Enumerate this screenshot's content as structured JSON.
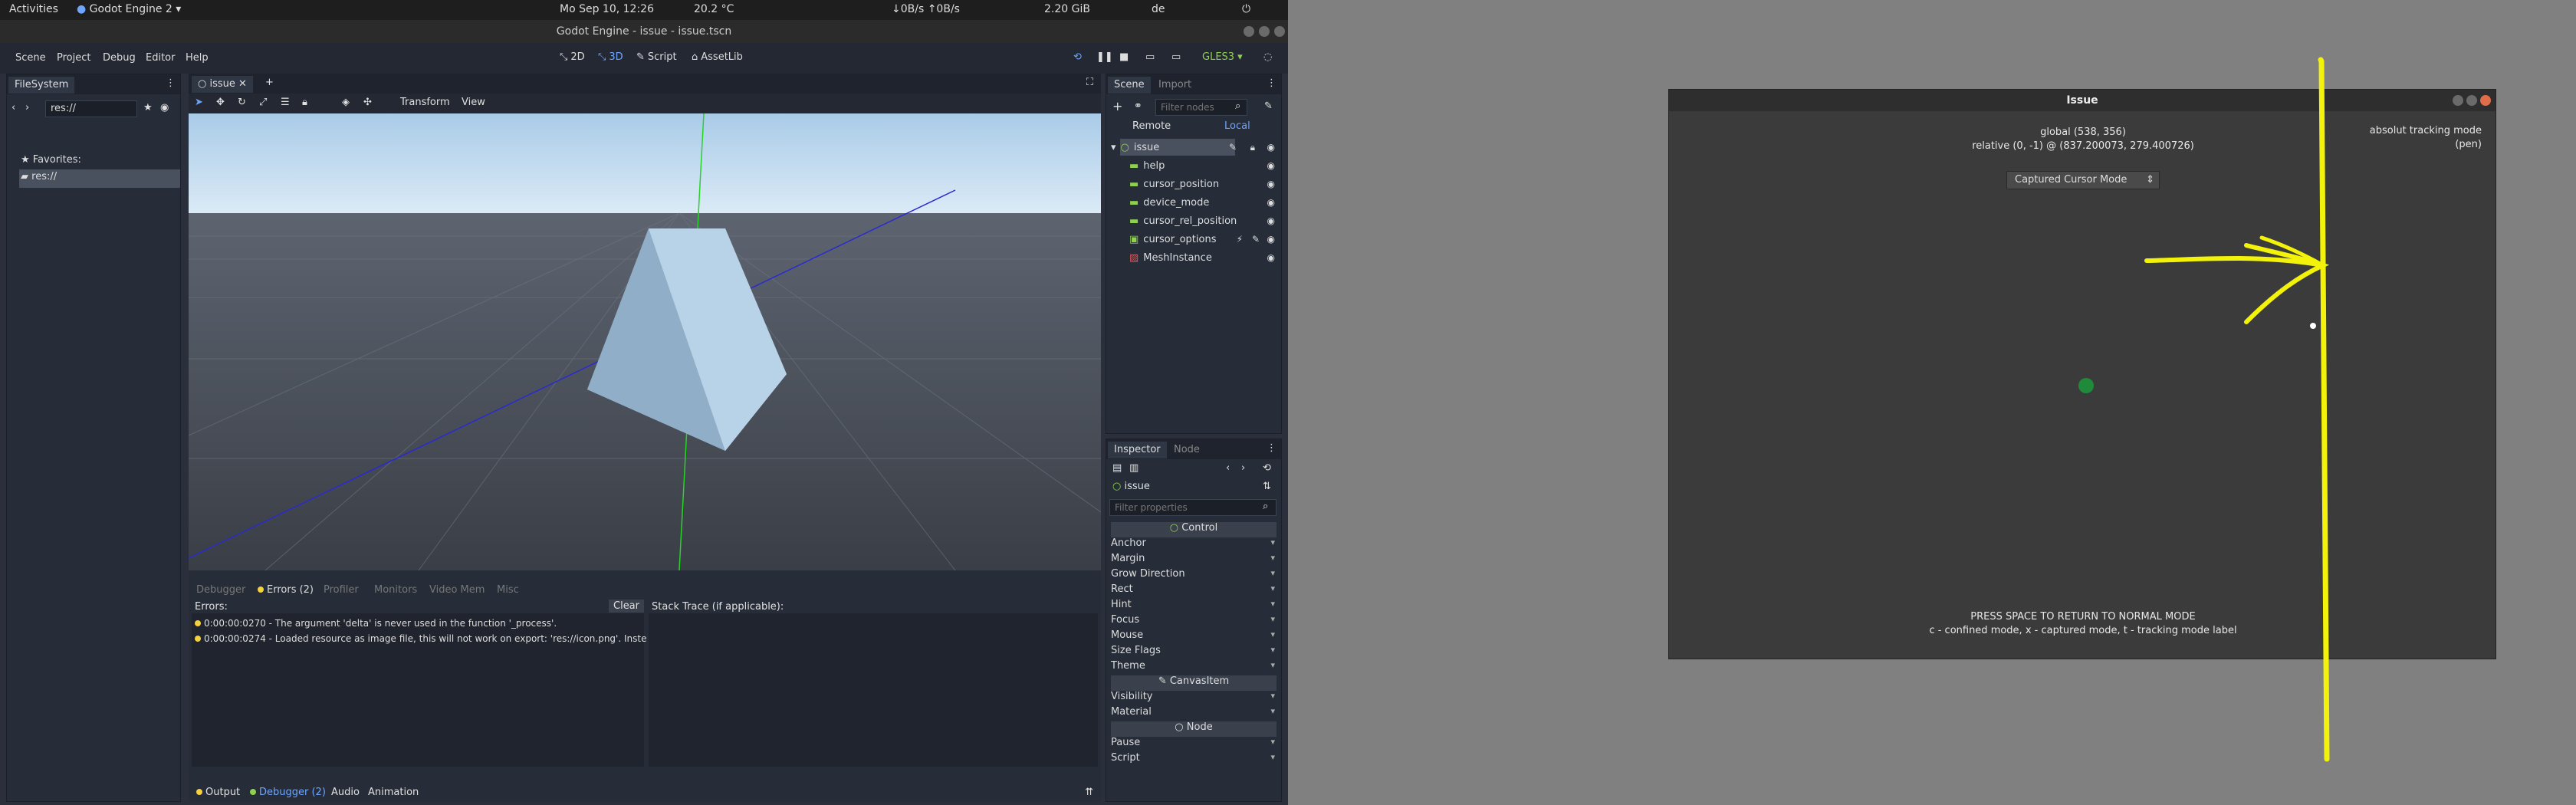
{
  "topbar": {
    "activities": "Activities",
    "app_name": "Godot Engine 2",
    "clock": "Mo Sep 10, 12:26",
    "weather": "20.2 °C",
    "net": "↓0B/s ↑0B/s",
    "mem": "2.20 GiB",
    "lang": "de"
  },
  "window_title": "Godot Engine - issue - issue.tscn",
  "menus": [
    "Scene",
    "Project",
    "Debug",
    "Editor",
    "Help"
  ],
  "workspaces": {
    "w2d": "2D",
    "w3d": "3D",
    "script": "Script",
    "assetlib": "AssetLib"
  },
  "renderer": "GLES3",
  "filesystem": {
    "tab": "FileSystem",
    "path": "res://",
    "favorites": "Favorites:",
    "root": "res://"
  },
  "viewport": {
    "scene_tab": "issue",
    "transform_menu": "Transform",
    "view_menu": "View"
  },
  "bottom": {
    "tabs": [
      "Debugger",
      "Errors (2)",
      "Profiler",
      "Monitors",
      "Video Mem",
      "Misc"
    ],
    "errors_label": "Errors:",
    "clear": "Clear",
    "stack_trace": "Stack Trace (if applicable):",
    "errors": [
      "0:00:00:0270 - The argument 'delta' is never used in the function '_process'.",
      "0:00:00:0274 - Loaded resource as image file, this will not work on export: 'res://icon.png'. Inste"
    ],
    "footer": {
      "output": "Output",
      "debugger": "Debugger (2)",
      "audio": "Audio",
      "animation": "Animation"
    }
  },
  "scene": {
    "tab_scene": "Scene",
    "tab_import": "Import",
    "filter_placeholder": "Filter nodes",
    "remote": "Remote",
    "local": "Local",
    "nodes": [
      "issue",
      "help",
      "cursor_position",
      "device_mode",
      "cursor_rel_position",
      "cursor_options",
      "MeshInstance"
    ]
  },
  "inspector": {
    "tab_inspector": "Inspector",
    "tab_node": "Node",
    "object": "issue",
    "filter_placeholder": "Filter properties",
    "sections": {
      "control": "Control",
      "canvasitem": "CanvasItem",
      "node": "Node"
    },
    "control_props": [
      "Anchor",
      "Margin",
      "Grow Direction",
      "Rect",
      "Hint",
      "Focus",
      "Mouse",
      "Size Flags",
      "Theme"
    ],
    "canvas_props": [
      "Visibility",
      "Material"
    ],
    "node_props": [
      "Pause",
      "Script"
    ]
  },
  "app": {
    "title": "Issue",
    "global": "global (538, 356)",
    "relative": "relative (0, -1) @ (837.200073, 279.400726)",
    "mode_select": "Captured Cursor Mode",
    "tracking": "absolut tracking mode",
    "tracking_device": "(pen)",
    "hint1": "PRESS SPACE TO RETURN TO NORMAL MODE",
    "hint2": "c - confined mode,  x - captured mode, t - tracking mode label"
  },
  "colors": {
    "accent": "#6ea6ff",
    "renderer": "#8fd14f",
    "drawing": "#f2f20a",
    "dot": "#1f8a3a"
  }
}
